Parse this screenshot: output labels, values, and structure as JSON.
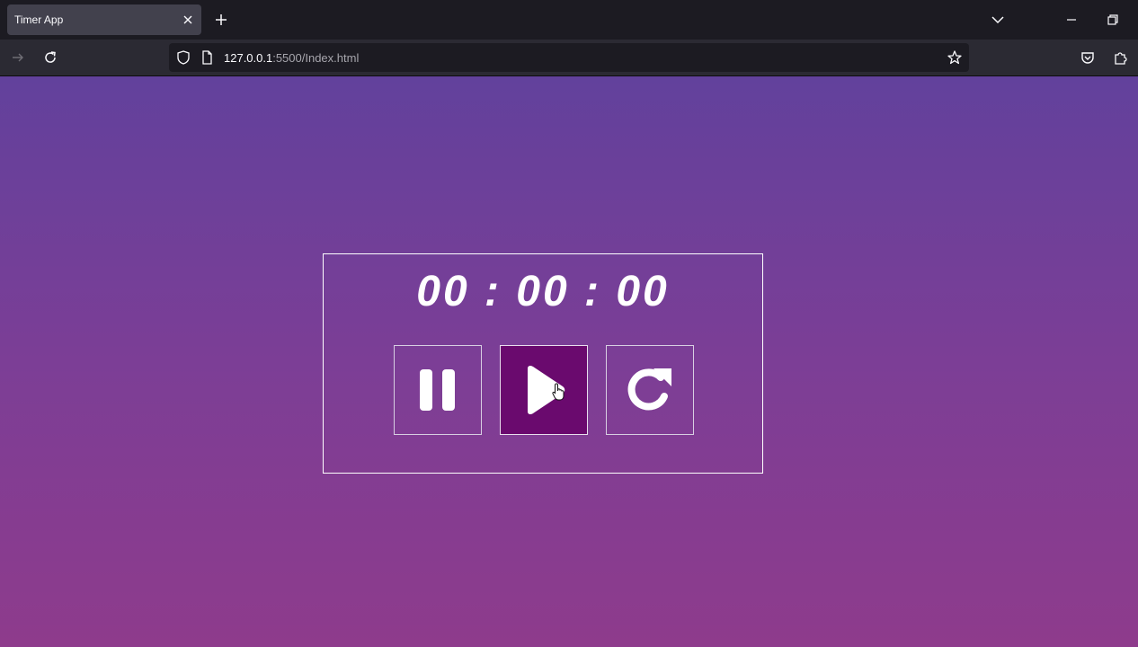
{
  "browser": {
    "tab": {
      "title": "Timer App"
    },
    "url": {
      "host": "127.0.0.1",
      "rest": ":5500/Index.html"
    }
  },
  "timer": {
    "display": "00 : 00 : 00",
    "buttons": [
      {
        "name": "pause",
        "icon": "pause-icon"
      },
      {
        "name": "play",
        "icon": "play-icon",
        "state": "hovered"
      },
      {
        "name": "reset",
        "icon": "rotate-cw-icon"
      }
    ]
  },
  "colors": {
    "gradient_top": "#62419c",
    "gradient_bottom": "#8e3b8c",
    "play_active": "#6a0a6e",
    "text": "#ffffff"
  }
}
